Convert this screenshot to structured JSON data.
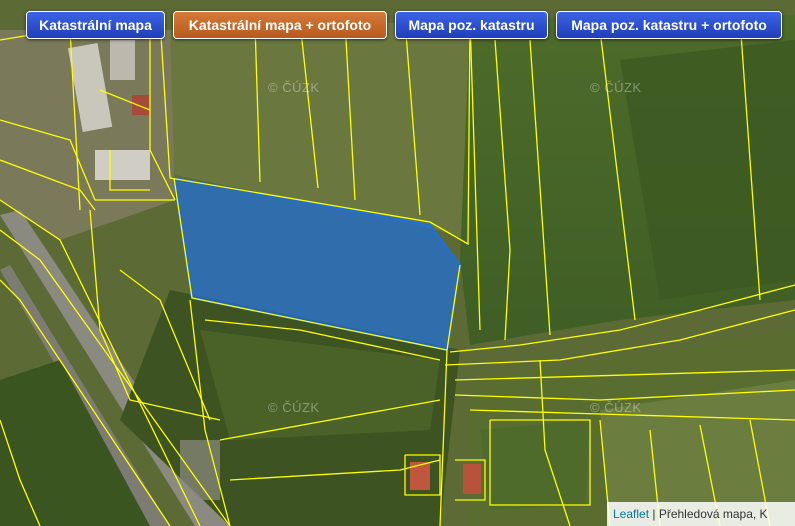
{
  "layer_buttons": [
    {
      "label": "Katastrální mapa",
      "active": false
    },
    {
      "label": "Katastrální mapa + ortofoto",
      "active": true
    },
    {
      "label": "Mapa poz. katastru",
      "active": false
    },
    {
      "label": "Mapa poz. katastru + ortofoto",
      "active": false
    }
  ],
  "watermark": "© ČÚZK",
  "attribution": {
    "link": "Leaflet",
    "separator": " | ",
    "text": "Přehledová mapa, K"
  },
  "colors": {
    "parcel_lines": "#ffff00",
    "selected_parcel_fill": "#1e6fe0",
    "button_active": "#c8682a",
    "button_default": "#2a4fd8"
  },
  "icons": {
    "map": "orthophoto-cadastral-map"
  }
}
